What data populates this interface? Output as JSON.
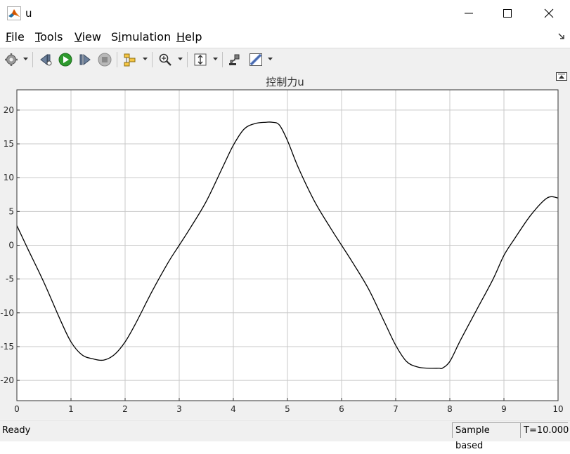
{
  "window": {
    "title": "u"
  },
  "menu": {
    "items": [
      {
        "label": "File",
        "key": "F",
        "rest": "ile"
      },
      {
        "label": "Tools",
        "key": "T",
        "rest": "ools"
      },
      {
        "label": "View",
        "key": "V",
        "rest": "iew"
      },
      {
        "label": "Simulation",
        "pre": "S",
        "key": "i",
        "rest": "mulation"
      },
      {
        "label": "Help",
        "key": "H",
        "rest": "elp"
      }
    ]
  },
  "toolbar": {
    "icons": [
      "gear-icon",
      "step-back-icon",
      "run-icon",
      "step-forward-icon",
      "stop-icon",
      "signal-select-icon",
      "zoom-icon",
      "autoscale-icon",
      "highlight-block-icon",
      "measurement-icon"
    ]
  },
  "chart_data": {
    "type": "line",
    "title": "控制力u",
    "xlabel": "",
    "ylabel": "",
    "xlim": [
      0,
      10
    ],
    "ylim": [
      -23,
      23
    ],
    "xticks": [
      0,
      1,
      2,
      3,
      4,
      5,
      6,
      7,
      8,
      9,
      10
    ],
    "yticks": [
      20,
      15,
      10,
      5,
      0,
      -5,
      -10,
      -15,
      -20
    ],
    "grid": true,
    "line_color": "#000000",
    "series": [
      {
        "x": [
          0,
          0.2,
          0.5,
          0.8,
          1.0,
          1.2,
          1.4,
          1.6,
          1.8,
          2.0,
          2.2,
          2.5,
          2.8,
          3.0,
          3.2,
          3.5,
          3.8,
          4.0,
          4.2,
          4.4,
          4.6,
          4.72,
          4.85,
          5.0,
          5.2,
          5.5,
          5.8,
          6.0,
          6.2,
          6.5,
          6.8,
          7.0,
          7.2,
          7.4,
          7.6,
          7.8,
          7.86,
          8.0,
          8.2,
          8.5,
          8.8,
          9.0,
          9.2,
          9.5,
          9.8,
          10.0
        ],
        "y": [
          2.9,
          -0.5,
          -5.5,
          -11.0,
          -14.3,
          -16.2,
          -16.8,
          -17.0,
          -16.2,
          -14.3,
          -11.5,
          -6.8,
          -2.5,
          0.0,
          2.5,
          6.5,
          11.5,
          14.8,
          17.2,
          18.0,
          18.2,
          18.2,
          17.8,
          15.5,
          11.5,
          6.5,
          2.5,
          0.0,
          -2.5,
          -6.5,
          -11.5,
          -14.8,
          -17.2,
          -18.0,
          -18.2,
          -18.2,
          -18.2,
          -17.2,
          -14.0,
          -9.5,
          -5.0,
          -1.5,
          1.0,
          4.5,
          7.0,
          7.0
        ]
      }
    ]
  },
  "status": {
    "ready": "Ready",
    "sample_mode": "Sample based",
    "time": "T=10.000"
  }
}
